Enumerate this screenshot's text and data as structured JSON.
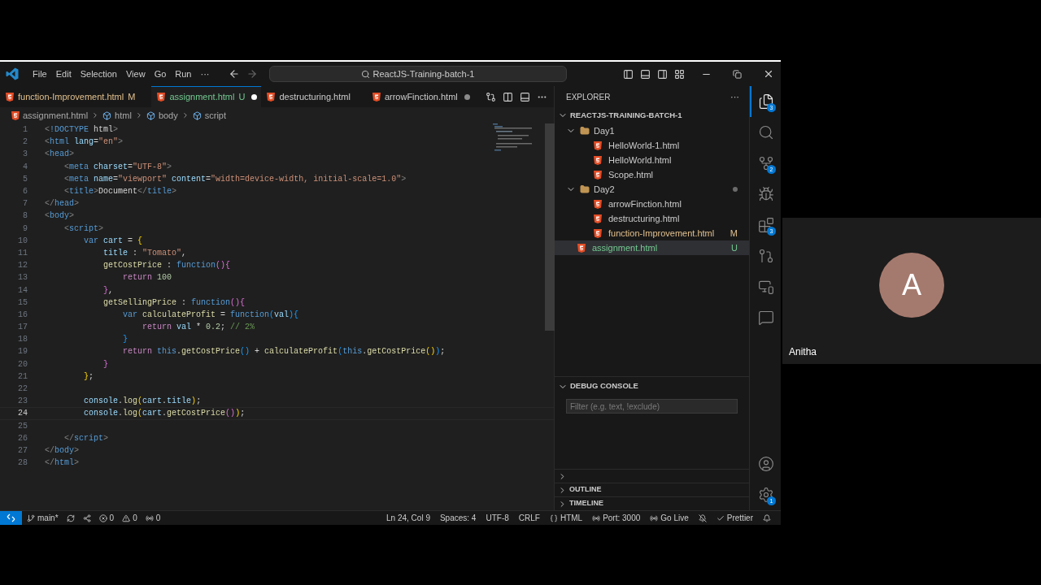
{
  "menu": [
    "File",
    "Edit",
    "Selection",
    "View",
    "Go",
    "Run",
    "···"
  ],
  "command_center": {
    "text": "ReactJS-Training-batch-1"
  },
  "tabs": [
    {
      "label": "function-Improvement.html",
      "badge": "M",
      "color": "#e2c08d",
      "dirty": false,
      "selected": false
    },
    {
      "label": "assignment.html",
      "badge": "U",
      "color": "#73c991",
      "dirty": true,
      "selected": true
    },
    {
      "label": "destructuring.html",
      "color": "#cccccc",
      "dirty": false,
      "selected": false
    },
    {
      "label": "arrowFinction.html",
      "color": "#cccccc",
      "dirty": true,
      "selected": false
    }
  ],
  "breadcrumb": [
    {
      "kind": "file",
      "label": "assignment.html"
    },
    {
      "kind": "element",
      "label": "html"
    },
    {
      "kind": "element",
      "label": "body"
    },
    {
      "kind": "element",
      "label": "script"
    }
  ],
  "code": [
    {
      "number": "1",
      "current": false,
      "tokens": [
        {
          "kind": "punct",
          "t": "<"
        },
        {
          "kind": "tag",
          "t": "!DOCTYPE"
        },
        {
          "kind": "text",
          "t": " html"
        },
        {
          "kind": "punct",
          "t": ">"
        }
      ]
    },
    {
      "number": "2",
      "current": false,
      "tokens": [
        {
          "kind": "punct",
          "t": "<"
        },
        {
          "kind": "tag",
          "t": "html"
        },
        {
          "kind": "attr",
          "t": " lang"
        },
        {
          "kind": "text",
          "t": "="
        },
        {
          "kind": "str",
          "t": "\"en\""
        },
        {
          "kind": "punct",
          "t": ">"
        }
      ]
    },
    {
      "number": "3",
      "current": false,
      "tokens": [
        {
          "kind": "punct",
          "t": "<"
        },
        {
          "kind": "tag",
          "t": "head"
        },
        {
          "kind": "punct",
          "t": ">"
        }
      ]
    },
    {
      "number": "4",
      "current": false,
      "tokens": [
        {
          "kind": "punct",
          "t": "    <"
        },
        {
          "kind": "tag",
          "t": "meta"
        },
        {
          "kind": "attr",
          "t": " charset"
        },
        {
          "kind": "text",
          "t": "="
        },
        {
          "kind": "str",
          "t": "\"UTF-8\""
        },
        {
          "kind": "punct",
          "t": ">"
        }
      ]
    },
    {
      "number": "5",
      "current": false,
      "tokens": [
        {
          "kind": "punct",
          "t": "    <"
        },
        {
          "kind": "tag",
          "t": "meta"
        },
        {
          "kind": "attr",
          "t": " name"
        },
        {
          "kind": "text",
          "t": "="
        },
        {
          "kind": "str",
          "t": "\"viewport\""
        },
        {
          "kind": "attr",
          "t": " content"
        },
        {
          "kind": "text",
          "t": "="
        },
        {
          "kind": "str",
          "t": "\"width=device-width, initial-scale=1.0\""
        },
        {
          "kind": "punct",
          "t": ">"
        }
      ]
    },
    {
      "number": "6",
      "current": false,
      "tokens": [
        {
          "kind": "punct",
          "t": "    <"
        },
        {
          "kind": "tag",
          "t": "title"
        },
        {
          "kind": "punct",
          "t": ">"
        },
        {
          "kind": "text",
          "t": "Document"
        },
        {
          "kind": "punct",
          "t": "</"
        },
        {
          "kind": "tag",
          "t": "title"
        },
        {
          "kind": "punct",
          "t": ">"
        }
      ]
    },
    {
      "number": "7",
      "current": false,
      "tokens": [
        {
          "kind": "punct",
          "t": "</"
        },
        {
          "kind": "tag",
          "t": "head"
        },
        {
          "kind": "punct",
          "t": ">"
        }
      ]
    },
    {
      "number": "8",
      "current": false,
      "tokens": [
        {
          "kind": "punct",
          "t": "<"
        },
        {
          "kind": "tag",
          "t": "body"
        },
        {
          "kind": "punct",
          "t": ">"
        }
      ]
    },
    {
      "number": "9",
      "current": false,
      "tokens": [
        {
          "kind": "punct",
          "t": "    <"
        },
        {
          "kind": "tag",
          "t": "script"
        },
        {
          "kind": "punct",
          "t": ">"
        }
      ]
    },
    {
      "number": "10",
      "current": false,
      "tokens": [
        {
          "kind": "kw",
          "t": "        var"
        },
        {
          "kind": "var",
          "t": " cart"
        },
        {
          "kind": "text",
          "t": " = "
        },
        {
          "kind": "b1",
          "t": "{"
        }
      ]
    },
    {
      "number": "11",
      "current": false,
      "tokens": [
        {
          "kind": "var",
          "t": "            title"
        },
        {
          "kind": "text",
          "t": " : "
        },
        {
          "kind": "str",
          "t": "\"Tomato\""
        },
        {
          "kind": "text",
          "t": ","
        }
      ]
    },
    {
      "number": "12",
      "current": false,
      "tokens": [
        {
          "kind": "fn",
          "t": "            getCostPrice"
        },
        {
          "kind": "text",
          "t": " : "
        },
        {
          "kind": "kw",
          "t": "function"
        },
        {
          "kind": "b2",
          "t": "(){"
        }
      ]
    },
    {
      "number": "13",
      "current": false,
      "tokens": [
        {
          "kind": "ctrl",
          "t": "                return"
        },
        {
          "kind": "num",
          "t": " 100"
        }
      ]
    },
    {
      "number": "14",
      "current": false,
      "tokens": [
        {
          "kind": "b2",
          "t": "            }"
        },
        {
          "kind": "text",
          "t": ","
        }
      ]
    },
    {
      "number": "15",
      "current": false,
      "tokens": [
        {
          "kind": "fn",
          "t": "            getSellingPrice"
        },
        {
          "kind": "text",
          "t": " : "
        },
        {
          "kind": "kw",
          "t": "function"
        },
        {
          "kind": "b2",
          "t": "(){"
        }
      ]
    },
    {
      "number": "16",
      "current": false,
      "tokens": [
        {
          "kind": "kw",
          "t": "                var"
        },
        {
          "kind": "fn",
          "t": " calculateProfit"
        },
        {
          "kind": "text",
          "t": " = "
        },
        {
          "kind": "kw",
          "t": "function"
        },
        {
          "kind": "b3",
          "t": "("
        },
        {
          "kind": "var",
          "t": "val"
        },
        {
          "kind": "b3",
          "t": "){"
        }
      ]
    },
    {
      "number": "17",
      "current": false,
      "tokens": [
        {
          "kind": "ctrl",
          "t": "                    return"
        },
        {
          "kind": "var",
          "t": " val"
        },
        {
          "kind": "text",
          "t": " * "
        },
        {
          "kind": "num",
          "t": "0.2"
        },
        {
          "kind": "text",
          "t": "; "
        },
        {
          "kind": "cmt",
          "t": "// 2%"
        }
      ]
    },
    {
      "number": "18",
      "current": false,
      "tokens": [
        {
          "kind": "b3",
          "t": "                }"
        }
      ]
    },
    {
      "number": "19",
      "current": false,
      "tokens": [
        {
          "kind": "ctrl",
          "t": "                return"
        },
        {
          "kind": "kw",
          "t": " this"
        },
        {
          "kind": "text",
          "t": "."
        },
        {
          "kind": "fn",
          "t": "getCostPrice"
        },
        {
          "kind": "b3",
          "t": "()"
        },
        {
          "kind": "text",
          "t": " + "
        },
        {
          "kind": "fn",
          "t": "calculateProfit"
        },
        {
          "kind": "b3",
          "t": "("
        },
        {
          "kind": "kw",
          "t": "this"
        },
        {
          "kind": "text",
          "t": "."
        },
        {
          "kind": "fn",
          "t": "getCostPrice"
        },
        {
          "kind": "b1",
          "t": "()"
        },
        {
          "kind": "b3",
          "t": ")"
        },
        {
          "kind": "text",
          "t": ";"
        }
      ]
    },
    {
      "number": "20",
      "current": false,
      "tokens": [
        {
          "kind": "b2",
          "t": "            }"
        }
      ]
    },
    {
      "number": "21",
      "current": false,
      "tokens": [
        {
          "kind": "b1",
          "t": "        }"
        },
        {
          "kind": "text",
          "t": ";"
        }
      ]
    },
    {
      "number": "22",
      "current": false
    },
    {
      "number": "23",
      "current": false,
      "tokens": [
        {
          "kind": "var",
          "t": "        console"
        },
        {
          "kind": "text",
          "t": "."
        },
        {
          "kind": "fn",
          "t": "log"
        },
        {
          "kind": "b1",
          "t": "("
        },
        {
          "kind": "var",
          "t": "cart"
        },
        {
          "kind": "text",
          "t": "."
        },
        {
          "kind": "var",
          "t": "title"
        },
        {
          "kind": "b1",
          "t": ")"
        },
        {
          "kind": "text",
          "t": ";"
        }
      ]
    },
    {
      "number": "24",
      "current": true,
      "tokens": [
        {
          "kind": "var",
          "t": "        console"
        },
        {
          "kind": "text",
          "t": "."
        },
        {
          "kind": "fn",
          "t": "log"
        },
        {
          "kind": "b1",
          "t": "("
        },
        {
          "kind": "var",
          "t": "cart"
        },
        {
          "kind": "text",
          "t": "."
        },
        {
          "kind": "fn",
          "t": "getCostPrice"
        },
        {
          "kind": "b2",
          "t": "()"
        },
        {
          "kind": "b1",
          "t": ")"
        },
        {
          "kind": "text",
          "t": ";"
        }
      ]
    },
    {
      "number": "25",
      "current": false
    },
    {
      "number": "26",
      "current": false,
      "tokens": [
        {
          "kind": "punct",
          "t": "    </"
        },
        {
          "kind": "tag",
          "t": "script"
        },
        {
          "kind": "punct",
          "t": ">"
        }
      ]
    },
    {
      "number": "27",
      "current": false,
      "tokens": [
        {
          "kind": "punct",
          "t": "</"
        },
        {
          "kind": "tag",
          "t": "body"
        },
        {
          "kind": "punct",
          "t": ">"
        }
      ]
    },
    {
      "number": "28",
      "current": false,
      "tokens": [
        {
          "kind": "punct",
          "t": "</"
        },
        {
          "kind": "tag",
          "t": "html"
        },
        {
          "kind": "punct",
          "t": ">"
        }
      ]
    }
  ],
  "explorer": {
    "title": "EXPLORER",
    "more": "···",
    "root": {
      "label": "REACTJS-TRAINING-BATCH-1",
      "expanded": true,
      "children": [
        {
          "kind": "folder",
          "label": "Day1",
          "expanded": true,
          "dot": false,
          "selected": false,
          "children": [
            {
              "kind": "file",
              "label": "HelloWorld-1.html",
              "color": "#cccccc",
              "selected": false
            },
            {
              "kind": "file",
              "label": "HelloWorld.html",
              "color": "#cccccc",
              "selected": false
            },
            {
              "kind": "file",
              "label": "Scope.html",
              "color": "#cccccc",
              "selected": false
            }
          ]
        },
        {
          "kind": "folder",
          "label": "Day2",
          "expanded": true,
          "dot": true,
          "selected": false,
          "children": [
            {
              "kind": "file",
              "label": "arrowFinction.html",
              "color": "#cccccc",
              "selected": false
            },
            {
              "kind": "file",
              "label": "destructuring.html",
              "color": "#cccccc",
              "selected": false
            },
            {
              "kind": "file",
              "label": "function-Improvement.html",
              "badge": "M",
              "color": "#e2c08d",
              "selected": false
            }
          ]
        },
        {
          "kind": "file",
          "label": "assignment.html",
          "badge": "U",
          "color": "#73c991",
          "selected": true
        }
      ]
    }
  },
  "debug_console": {
    "title": "DEBUG CONSOLE",
    "expanded": true,
    "filter": {
      "placeholder": "Filter (e.g. text, !exclude)"
    }
  },
  "panels": [
    {
      "expanded": false
    },
    {
      "label": "OUTLINE",
      "expanded": false
    },
    {
      "label": "TIMELINE",
      "expanded": false
    }
  ],
  "activity_bar": [
    {
      "kind": "files",
      "badge": "3",
      "selected": true
    },
    {
      "kind": "search",
      "selected": false
    },
    {
      "kind": "scm",
      "badge": "2",
      "selected": false
    },
    {
      "kind": "debug",
      "selected": false
    },
    {
      "kind": "extensions",
      "badge": "3",
      "selected": false
    },
    {
      "kind": "graph",
      "selected": false
    },
    {
      "kind": "remote",
      "selected": false
    },
    {
      "kind": "chat",
      "selected": false
    }
  ],
  "activity_bottom": [
    {
      "kind": "account"
    },
    {
      "kind": "settings",
      "badge": "1"
    }
  ],
  "status_bar": {
    "left": [
      {
        "kind": "branch",
        "text": "main*"
      },
      {
        "kind": "sync"
      },
      {
        "kind": "share"
      },
      {
        "kind": "errors",
        "text": "0"
      },
      {
        "kind": "warnings",
        "text": "0"
      },
      {
        "kind": "ports",
        "text": "0"
      }
    ],
    "right": [
      {
        "kind": "text",
        "text": "Ln 24, Col 9"
      },
      {
        "kind": "text",
        "text": "Spaces: 4"
      },
      {
        "kind": "text",
        "text": "UTF-8"
      },
      {
        "kind": "text",
        "text": "CRLF"
      },
      {
        "kind": "braces",
        "text": "HTML"
      },
      {
        "kind": "ports",
        "text": "Port: 3000"
      },
      {
        "kind": "live",
        "text": "Go Live"
      },
      {
        "kind": "belloff"
      },
      {
        "kind": "check",
        "text": "Prettier"
      },
      {
        "kind": "bell"
      }
    ]
  },
  "participant": {
    "initial": "A",
    "name": "Anitha"
  }
}
